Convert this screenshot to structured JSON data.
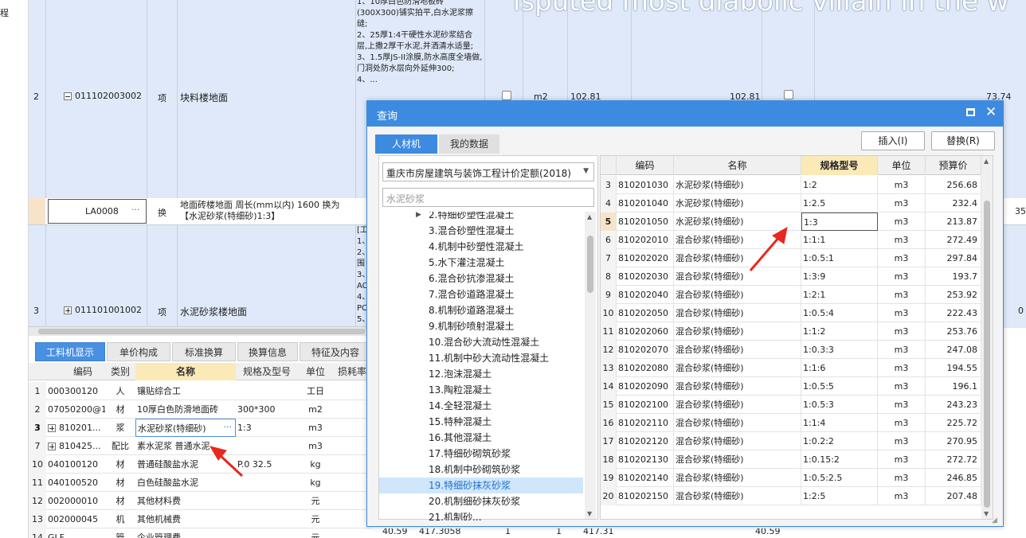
{
  "left_strip": {
    "label": "程"
  },
  "main_table": {
    "overlay_text": "isputed most diabolic villain in the w",
    "row2": {
      "num": "2",
      "code": "011102003002",
      "type": "项",
      "name": "块料楼地面",
      "desc": "1、10厚白色防滑地板砖(300X300)铺实拍平,白水泥浆擦缝;\n2、25厚1:4干硬性水泥砂浆结合层,上撒2厚干水泥,并洒清水适量;\n3、1.5厚JS-II涂膜,防水高度全墙做,门洞处防水层向外延伸300;\n4、...",
      "unit": "m2",
      "qty": "102.81",
      "qty2": "102.81",
      "price": "73.74"
    },
    "row_la": {
      "code": "LA0008",
      "type": "换",
      "name": "地面砖楼地面 周长(mm以内) 1600 换为【水泥砂浆(特细砂)1:3】",
      "right_val": "35"
    },
    "row3": {
      "num": "3",
      "code": "011101001002",
      "type": "项",
      "name": "水泥砂浆楼地面",
      "desc": "[工\n1、\n2、\n围\n3、\nAC\n4、\nPC\n5、",
      "right_val": "0"
    }
  },
  "bottom_tabs": [
    "工料机显示",
    "单价构成",
    "标准换算",
    "换算信息",
    "特征及内容"
  ],
  "bottom_grid": {
    "headers": [
      "编码",
      "类别",
      "名称",
      "规格及型号",
      "单位",
      "损耗率"
    ],
    "rows": [
      {
        "num": "1",
        "code": "000300120",
        "cat": "人",
        "name": "镶贴综合工",
        "spec": "",
        "unit": "工日"
      },
      {
        "num": "2",
        "code": "07050200@1",
        "cat": "材",
        "name": "10厚白色防滑地面砖",
        "spec": "300*300",
        "unit": "m2"
      },
      {
        "num": "3",
        "code": "810201...",
        "cat": "浆",
        "name": "水泥砂浆(特细砂)",
        "spec": "1:3",
        "unit": "m3"
      },
      {
        "num": "7",
        "code": "810425...",
        "cat": "配比",
        "name": "素水泥浆 普通水泥",
        "spec": "",
        "unit": "m3"
      },
      {
        "num": "10",
        "code": "040100120",
        "cat": "材",
        "name": "普通硅酸盐水泥",
        "spec": "P.0 32.5",
        "unit": "kg"
      },
      {
        "num": "11",
        "code": "040100520",
        "cat": "材",
        "name": "白色硅酸盐水泥",
        "spec": "",
        "unit": "kg"
      },
      {
        "num": "12",
        "code": "002000010",
        "cat": "材",
        "name": "其他材料费",
        "spec": "",
        "unit": "元"
      },
      {
        "num": "13",
        "code": "002000045",
        "cat": "机",
        "name": "其他机械费",
        "spec": "",
        "unit": "元"
      },
      {
        "num": "14",
        "code": "GLF",
        "cat": "管",
        "name": "企业管理费",
        "spec": "",
        "unit": "元"
      }
    ],
    "row14_extra": [
      "40.59",
      "417.3058",
      "1",
      "1",
      "417.31",
      "40.59"
    ],
    "ellipsis": "···"
  },
  "dialog": {
    "title": "查询",
    "tabs": [
      "人材机",
      "我的数据"
    ],
    "insert_label": "插入(I)",
    "replace_label": "替换(R)",
    "dropdown_value": "重庆市房屋建筑与装饰工程计价定额(2018)",
    "search_placeholder": "水泥砂浆",
    "tree": [
      "2.特细砂塑性混凝土",
      "3.混合砂塑性混凝土",
      "4.机制中砂塑性混凝土",
      "5.水下灌注混凝土",
      "6.混合砂抗渗混凝土",
      "7.混合砂道路混凝土",
      "8.机制砂道路混凝土",
      "9.机制砂喷射混凝土",
      "10.混合砂大流动性混凝土",
      "11.机制中砂大流动性混凝土",
      "12.泡沫混凝土",
      "13.陶粒混凝土",
      "14.全轻混凝土",
      "15.特种混凝土",
      "16.其他混凝土",
      "17.特细砂砌筑砂浆",
      "18.机制中砂砌筑砂浆",
      "19.特细砂抹灰砂浆",
      "20.机制细砂抹灰砂浆",
      "21.机制砂..."
    ],
    "tree_selected_index": 17,
    "headers": [
      "编码",
      "名称",
      "规格型号",
      "单位",
      "预算价"
    ],
    "rows": [
      [
        "3",
        "810201030",
        "水泥砂浆(特细砂)",
        "1:2",
        "m3",
        "256.68"
      ],
      [
        "4",
        "810201040",
        "水泥砂浆(特细砂)",
        "1:2.5",
        "m3",
        "232.4"
      ],
      [
        "5",
        "810201050",
        "水泥砂浆(特细砂)",
        "1:3",
        "m3",
        "213.87"
      ],
      [
        "6",
        "810202010",
        "混合砂浆(特细砂)",
        "1:1:1",
        "m3",
        "272.49"
      ],
      [
        "7",
        "810202020",
        "混合砂浆(特细砂)",
        "1:0.5:1",
        "m3",
        "297.84"
      ],
      [
        "8",
        "810202030",
        "混合砂浆(特细砂)",
        "1:3:9",
        "m3",
        "193.7"
      ],
      [
        "9",
        "810202040",
        "混合砂浆(特细砂)",
        "1:2:1",
        "m3",
        "253.92"
      ],
      [
        "10",
        "810202050",
        "混合砂浆(特细砂)",
        "1:0.5:4",
        "m3",
        "222.43"
      ],
      [
        "11",
        "810202060",
        "混合砂浆(特细砂)",
        "1:1:2",
        "m3",
        "253.76"
      ],
      [
        "12",
        "810202070",
        "混合砂浆(特细砂)",
        "1:0.3:3",
        "m3",
        "247.08"
      ],
      [
        "13",
        "810202080",
        "混合砂浆(特细砂)",
        "1:1:6",
        "m3",
        "194.55"
      ],
      [
        "14",
        "810202090",
        "混合砂浆(特细砂)",
        "1:0.5:5",
        "m3",
        "196.1"
      ],
      [
        "15",
        "810202100",
        "混合砂浆(特细砂)",
        "1:0.5:3",
        "m3",
        "243.23"
      ],
      [
        "16",
        "810202110",
        "混合砂浆(特细砂)",
        "1:1:4",
        "m3",
        "225.72"
      ],
      [
        "17",
        "810202120",
        "混合砂浆(特细砂)",
        "1:0.2:2",
        "m3",
        "270.95"
      ],
      [
        "18",
        "810202130",
        "混合砂浆(特细砂)",
        "1:0.15:2",
        "m3",
        "272.72"
      ],
      [
        "19",
        "810202140",
        "混合砂浆(特细砂)",
        "1:0.5:2.5",
        "m3",
        "246.85"
      ],
      [
        "20",
        "810202150",
        "混合砂浆(特细砂)",
        "1:2:5",
        "m3",
        "207.48"
      ]
    ],
    "selected_row_index": 2
  },
  "colors": {
    "accent": "#3d8be0",
    "highlight": "#fbe9b7",
    "arrow": "#e8281f"
  }
}
